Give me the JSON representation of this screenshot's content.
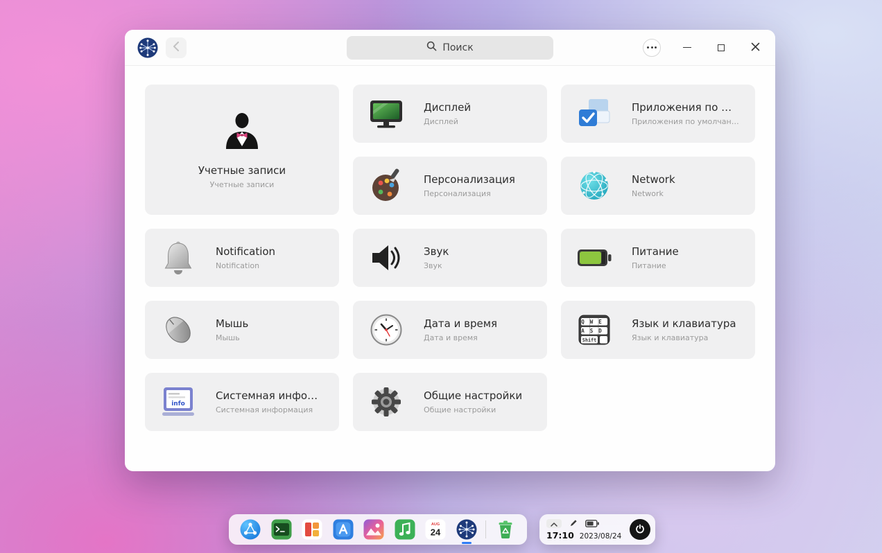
{
  "titlebar": {
    "search_placeholder": "Поиск"
  },
  "tiles": [
    {
      "title": "Учетные записи",
      "subtitle": "Учетные записи"
    },
    {
      "title": "Дисплей",
      "subtitle": "Дисплей"
    },
    {
      "title": "Приложения по умолчанию",
      "subtitle": "Приложения по умолчанию"
    },
    {
      "title": "Персонализация",
      "subtitle": "Персонализация"
    },
    {
      "title": "Network",
      "subtitle": "Network"
    },
    {
      "title": "Notification",
      "subtitle": "Notification"
    },
    {
      "title": "Звук",
      "subtitle": "Звук"
    },
    {
      "title": "Питание",
      "subtitle": "Питание"
    },
    {
      "title": "Мышь",
      "subtitle": "Мышь"
    },
    {
      "title": "Дата и время",
      "subtitle": "Дата и время"
    },
    {
      "title": "Язык и клавиатура",
      "subtitle": "Язык и клавиатура"
    },
    {
      "title": "Системная информация",
      "subtitle": "Системная информация"
    },
    {
      "title": "Общие настройки",
      "subtitle": "Общие настройки"
    }
  ],
  "icons": {
    "kb_row1": "QWE",
    "kb_row2": "ASD",
    "kb_row3": "Shift",
    "sysinfo_label": "info"
  },
  "dock": {
    "items": [
      "launcher",
      "terminal",
      "launchpad",
      "appstore",
      "gallery",
      "music",
      "calendar",
      "settings",
      "trash"
    ],
    "active_item": "settings",
    "calendar_month": "AUG",
    "calendar_day": "24"
  },
  "tray": {
    "time": "17:10",
    "date": "2023/08/24"
  },
  "colors": {
    "accent": "#2e7cf6",
    "tile_bg": "#f0f0f1"
  }
}
